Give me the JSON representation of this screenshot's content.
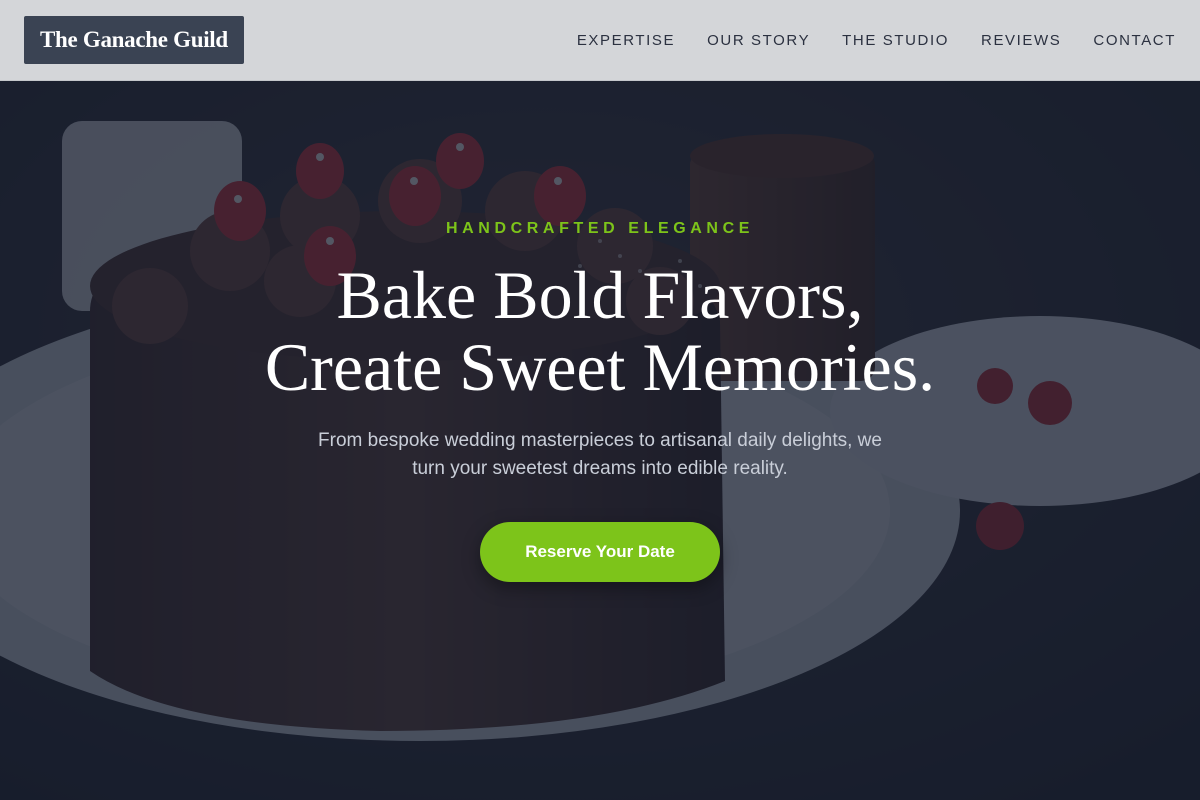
{
  "header": {
    "brand": "The Ganache Guild",
    "nav": [
      {
        "label": "EXPERTISE"
      },
      {
        "label": "OUR STORY"
      },
      {
        "label": "THE STUDIO"
      },
      {
        "label": "REVIEWS"
      },
      {
        "label": "CONTACT"
      }
    ]
  },
  "hero": {
    "eyebrow": "HANDCRAFTED ELEGANCE",
    "headline_line1": "Bake Bold Flavors,",
    "headline_line2": "Create Sweet Memories.",
    "subcopy_line1": "From bespoke wedding masterpieces to artisanal daily delights, we",
    "subcopy_line2": "turn your sweetest dreams into edible reality.",
    "cta_label": "Reserve Your Date"
  },
  "colors": {
    "accent": "#7dc41a",
    "header_bg": "#d4d6d9",
    "brand_bg": "#3a4353",
    "overlay": "#161e30"
  }
}
